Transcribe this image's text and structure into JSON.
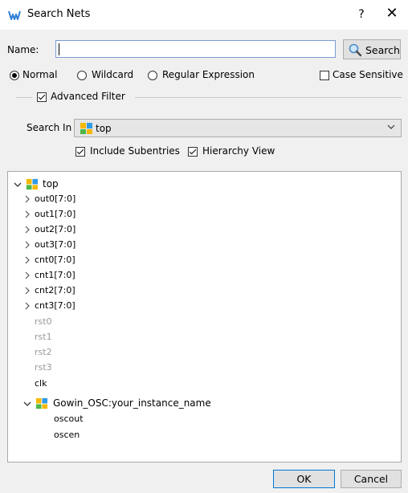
{
  "title": "Search Nets",
  "help": "?",
  "close": "✕",
  "name_label": "Name:",
  "name_value": "",
  "search_button": "Search",
  "modes": [
    {
      "label": "Normal",
      "selected": true
    },
    {
      "label": "Wildcard",
      "selected": false
    },
    {
      "label": "Regular Expression",
      "selected": false
    }
  ],
  "case_sensitive": {
    "label": "Case Sensitive",
    "checked": false
  },
  "advanced_filter": {
    "label": "Advanced Filter",
    "checked": true
  },
  "search_in": {
    "label": "Search In",
    "value": "top"
  },
  "include_subentries": {
    "label": "Include Subentries",
    "checked": true
  },
  "hierarchy_view": {
    "label": "Hierarchy View",
    "checked": true
  },
  "tree": {
    "root": "top",
    "nets": [
      "out0[7:0]",
      "out1[7:0]",
      "out2[7:0]",
      "out3[7:0]",
      "cnt0[7:0]",
      "cnt1[7:0]",
      "cnt2[7:0]",
      "cnt3[7:0]"
    ],
    "disabled": [
      "rst0",
      "rst1",
      "rst2",
      "rst3"
    ],
    "clk": "clk",
    "instance": "Gowin_OSC:your_instance_name",
    "instance_children": [
      "oscout",
      "oscen"
    ]
  },
  "ok": "OK",
  "cancel": "Cancel"
}
